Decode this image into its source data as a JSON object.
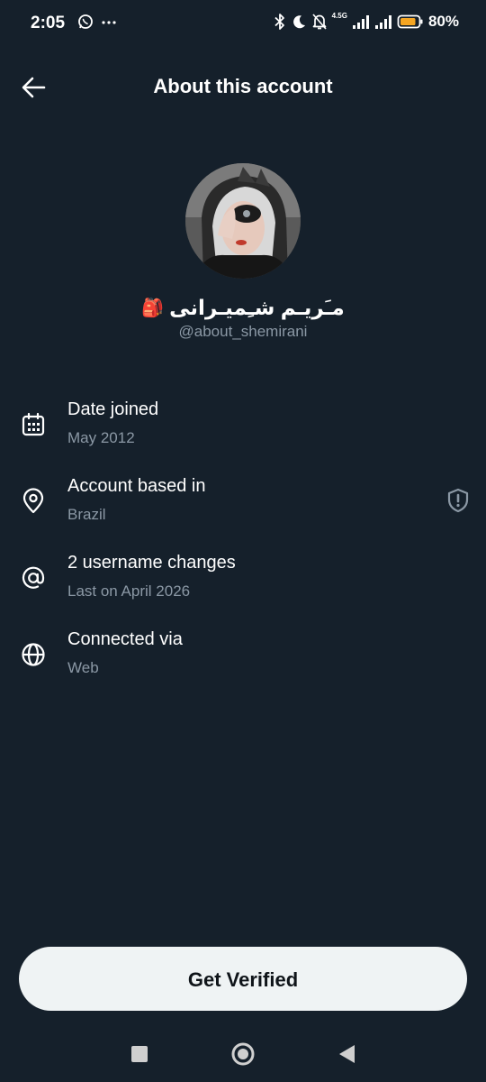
{
  "status_bar": {
    "time": "2:05",
    "network": "4.5G",
    "battery_percent": "80%",
    "icons": [
      "whatsapp-icon",
      "more-icon",
      "bluetooth-icon",
      "moon-icon",
      "bell-off-icon",
      "signal-icon",
      "battery-icon"
    ],
    "battery_color": "#f5a623"
  },
  "header": {
    "title": "About this account"
  },
  "profile": {
    "display_name": "مـَریـم شـِمیـرانی",
    "emoji": "🎒",
    "handle": "@about_shemirani"
  },
  "info_items": [
    {
      "icon": "calendar-icon",
      "title": "Date joined",
      "subtitle": "May 2012"
    },
    {
      "icon": "location-pin-icon",
      "title": "Account based in",
      "subtitle": "Brazil"
    },
    {
      "icon": "at-icon",
      "title": "2 username changes",
      "subtitle": "Last on April 2026"
    },
    {
      "icon": "globe-icon",
      "title": "Connected via",
      "subtitle": "Web"
    }
  ],
  "verify_button": {
    "label": "Get Verified"
  },
  "colors": {
    "background": "#15202b",
    "secondary_text": "#8b98a5",
    "button_bg": "#eff3f4",
    "button_text": "#0f1419"
  }
}
